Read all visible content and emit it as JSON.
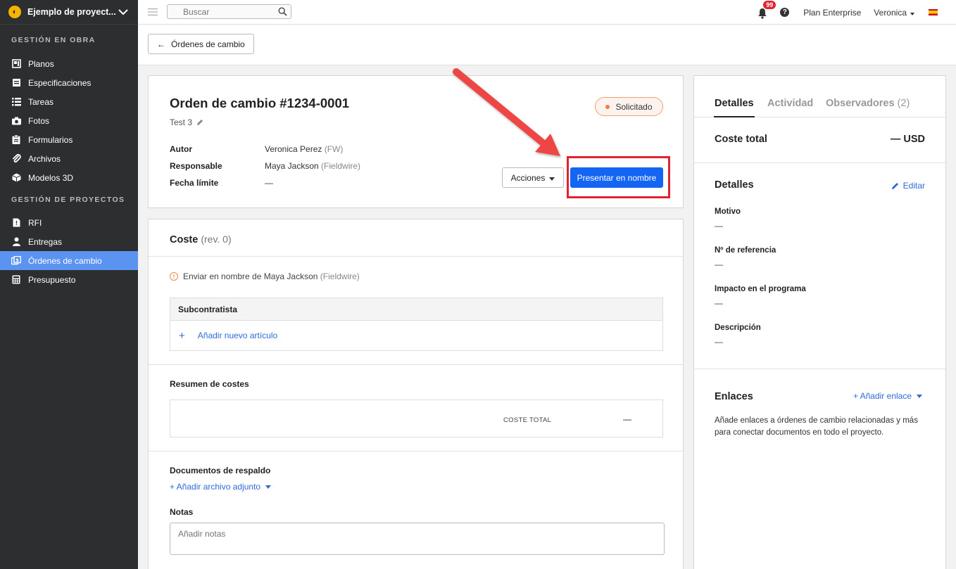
{
  "sidebar": {
    "project_title": "Ejemplo de proyect...",
    "sections": [
      {
        "label": "GESTIÓN EN OBRA",
        "items": [
          {
            "label": "Planos",
            "icon": "plans-icon"
          },
          {
            "label": "Especificaciones",
            "icon": "specifications-icon"
          },
          {
            "label": "Tareas",
            "icon": "tasks-icon"
          },
          {
            "label": "Fotos",
            "icon": "camera-icon"
          },
          {
            "label": "Formularios",
            "icon": "clipboard-icon"
          },
          {
            "label": "Archivos",
            "icon": "paperclip-icon"
          },
          {
            "label": "Modelos 3D",
            "icon": "cube-icon"
          }
        ]
      },
      {
        "label": "GESTIÓN DE PROYECTOS",
        "items": [
          {
            "label": "RFI",
            "icon": "rfi-icon"
          },
          {
            "label": "Entregas",
            "icon": "person-icon"
          },
          {
            "label": "Órdenes de cambio",
            "icon": "change-order-icon",
            "active": true
          },
          {
            "label": "Presupuesto",
            "icon": "calculator-icon"
          }
        ]
      }
    ]
  },
  "topbar": {
    "search_placeholder": "Buscar",
    "notifications_count": "99",
    "help": "?",
    "plan": "Plan Enterprise",
    "user": "Veronica"
  },
  "subbar": {
    "back_label": "Órdenes de cambio"
  },
  "order": {
    "title": "Orden de cambio #1234-0001",
    "subtitle": "Test 3",
    "status": "Solicitado",
    "author_label": "Autor",
    "author_name": "Veronica Perez",
    "author_org": "(FW)",
    "responsible_label": "Responsable",
    "responsible_name": "Maya Jackson",
    "responsible_org": "(Fieldwire)",
    "due_label": "Fecha límite",
    "due_value": "—",
    "actions_label": "Acciones",
    "submit_label": "Presentar en nombre"
  },
  "cost": {
    "title": "Coste",
    "revision": "(rev. 0)",
    "warning_text": "Enviar en nombre de Maya Jackson",
    "warning_org": "(Fieldwire)",
    "subcontractor_header": "Subcontratista",
    "add_item": "Añadir nuevo artículo",
    "summary_label": "Resumen de costes",
    "total_label": "COSTE TOTAL",
    "total_value": "—",
    "docs_label": "Documentos de respaldo",
    "add_attachment": "+ Añadir archivo adjunto",
    "notes_label": "Notas",
    "notes_placeholder": "Añadir notas"
  },
  "details_panel": {
    "tabs": [
      "Detalles",
      "Actividad",
      "Observadores"
    ],
    "observers_count": "(2)",
    "total_cost_label": "Coste total",
    "total_cost_value": "— USD",
    "details_title": "Detalles",
    "edit_label": "Editar",
    "fields": [
      {
        "label": "Motivo",
        "value": "—"
      },
      {
        "label": "Nº de referencia",
        "value": "—"
      },
      {
        "label": "Impacto en el programa",
        "value": "—"
      },
      {
        "label": "Descripción",
        "value": "—"
      }
    ],
    "links_title": "Enlaces",
    "add_link": "+ Añadir enlace",
    "links_text": "Añade enlaces a órdenes de cambio relacionadas y más para conectar documentos en todo el proyecto."
  },
  "colors": {
    "sidebar_bg": "#2c2e30",
    "active_item": "#5b93f0",
    "primary_button": "#1565f5",
    "highlight_red": "#e0242f",
    "status_orange": "#f57c3c"
  }
}
